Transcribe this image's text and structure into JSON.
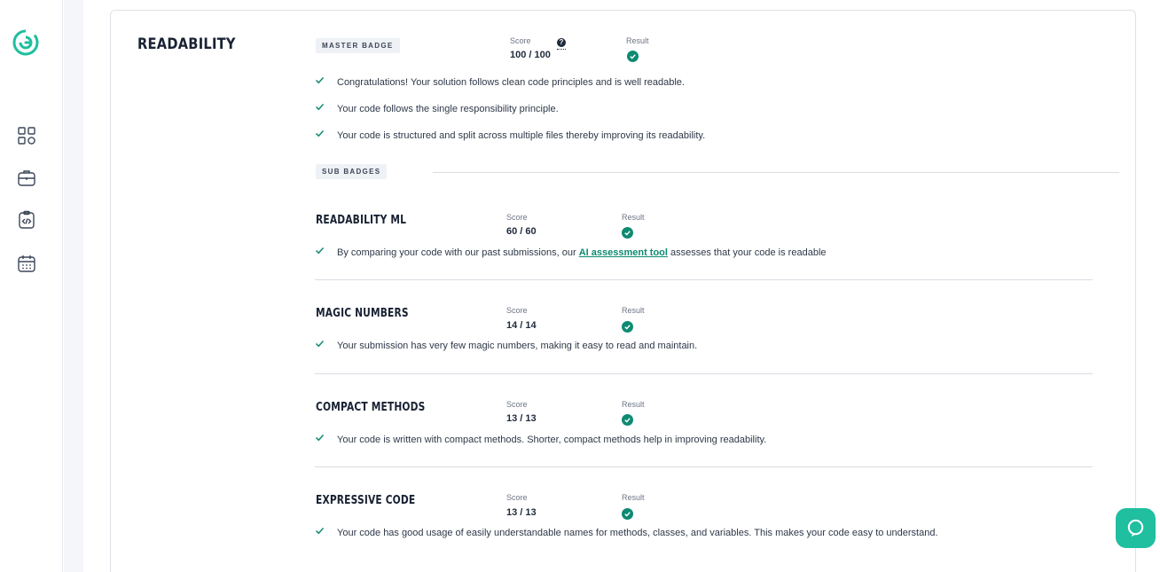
{
  "sidebar": {
    "logo": "logo-icon",
    "items": [
      {
        "icon": "dashboard-icon"
      },
      {
        "icon": "briefcase-icon"
      },
      {
        "icon": "code-clipboard-icon"
      },
      {
        "icon": "calendar-icon"
      }
    ]
  },
  "section": {
    "title": "READABILITY",
    "master_badge_label": "MASTER BADGE",
    "score_label": "Score",
    "score_value": "100 / 100",
    "help_glyph": "?",
    "result_label": "Result",
    "messages": [
      "Congratulations! Your solution follows clean code principles and is well readable.",
      "Your code follows the single responsibility principle.",
      "Your code is structured and split across multiple files thereby improving its readability."
    ],
    "sub_badges_label": "SUB BADGES"
  },
  "sub_badges": [
    {
      "title": "READABILITY ML",
      "score_label": "Score",
      "score_value": "60 / 60",
      "result_label": "Result",
      "message_pre": "By comparing your code with our past submissions, our ",
      "message_link": "AI assessment tool",
      "message_post": " assesses that your code is readable"
    },
    {
      "title": "MAGIC NUMBERS",
      "score_label": "Score",
      "score_value": "14 / 14",
      "result_label": "Result",
      "message": "Your submission has very few magic numbers, making it easy to read and maintain."
    },
    {
      "title": "COMPACT METHODS",
      "score_label": "Score",
      "score_value": "13 / 13",
      "result_label": "Result",
      "message": "Your code is written with compact methods. Shorter, compact methods help in improving readability."
    },
    {
      "title": "EXPRESSIVE CODE",
      "score_label": "Score",
      "score_value": "13 / 13",
      "result_label": "Result",
      "message": "Your code has good usage of easily understandable names for methods, classes, and variables. This makes your code easy to understand."
    }
  ],
  "colors": {
    "accent": "#1fbf9f",
    "success": "#0f8a72",
    "title": "#182233"
  },
  "chat": {
    "icon": "chat-support-icon"
  }
}
